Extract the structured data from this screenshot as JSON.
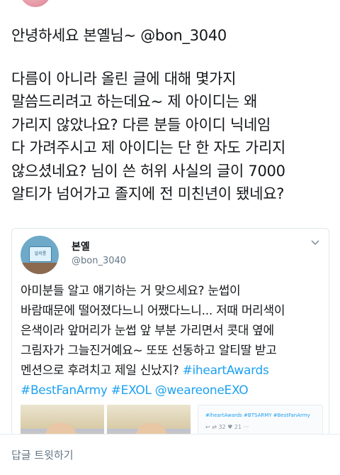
{
  "tweet": {
    "lines": [
      "안녕하세요 본옐님~ @bon_3040",
      "다름이 아니라 올린 글에 대해 몇가지",
      "말씀드리려고 하는데요~ 제 아이디는 왜",
      "가리지 않았나요? 다른 분들 아이디 닉네임",
      "다 가려주시고 제 아이디는 단 한 자도 가리지",
      "않으셨네요? 님이 쓴 허위 사실의 글이 7000",
      "알티가 넘어가고 졸지에 전 미친년이 됐네요?"
    ]
  },
  "quoted": {
    "name": "본옐",
    "handle": "@bon_3040",
    "avatar_sign_text": "알지롱",
    "lines": [
      "아미분들 알고 얘기하는 거 맞으세요? 눈썹이",
      "바람때문에 떨어졌다느니 어쨌다느니... 저때 머리색이",
      "은색이라 앞머리가 눈썹 앞 부분 가리면서 콧대 옆에",
      "그림자가 그늘진거예요~ 또또 선동하고 알티딸 받고",
      "멘션으로 후려치고 제일 신났지? "
    ],
    "hashtag_inline": "#iheartAwards",
    "hashtags_line": "#BestFanArmy #EXOL @weareoneEXO",
    "embedded_shot": {
      "hashtags": "#iheartAwards #BTSARMY #BestFanArmy",
      "icons": "↩   ⇄ 32    ♥ 21    ···"
    }
  },
  "reply_bar": {
    "label": "답글 트윗하기"
  },
  "colors": {
    "text": "#14171a",
    "secondary": "#657786",
    "link": "#1da1f2",
    "border": "#e1e8ed"
  }
}
